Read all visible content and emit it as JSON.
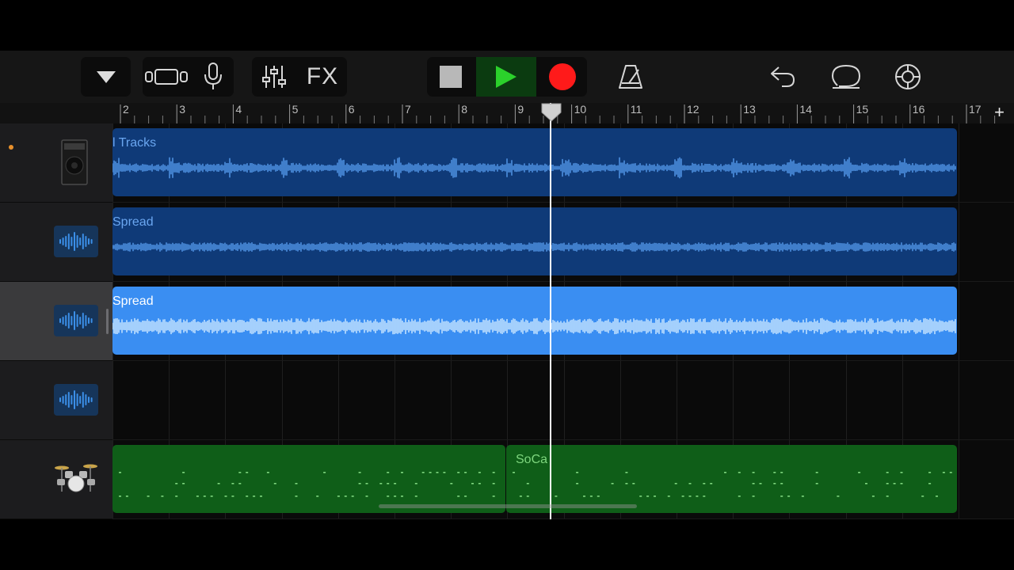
{
  "toolbar": {
    "buttons": [
      {
        "name": "browser",
        "icon": "triangle-down-icon"
      },
      {
        "name": "tracks-view",
        "icon": "tracks-view-icon"
      },
      {
        "name": "microphone",
        "icon": "microphone-icon"
      },
      {
        "name": "mixer",
        "icon": "mixer-sliders-icon"
      },
      {
        "name": "fx",
        "label": "FX"
      },
      {
        "name": "stop",
        "icon": "stop-icon"
      },
      {
        "name": "play",
        "icon": "play-icon"
      },
      {
        "name": "record",
        "icon": "record-icon"
      },
      {
        "name": "metronome",
        "icon": "metronome-icon"
      },
      {
        "name": "undo",
        "icon": "undo-icon"
      },
      {
        "name": "loop",
        "icon": "loop-icon"
      },
      {
        "name": "settings",
        "icon": "gear-icon"
      }
    ],
    "fx_label": "FX"
  },
  "ruler": {
    "bars": [
      "2",
      "3",
      "4",
      "5",
      "6",
      "7",
      "8",
      "9",
      "10",
      "11",
      "12",
      "13",
      "14",
      "15",
      "16",
      "17"
    ],
    "add_label": "+"
  },
  "tracks": [
    {
      "icon": "amp-icon",
      "selected": false,
      "region_label": "l Tracks",
      "type": "audio-dark",
      "recording_dot": true
    },
    {
      "icon": "waveform-icon",
      "selected": false,
      "region_label": "Spread",
      "type": "audio-dark"
    },
    {
      "icon": "waveform-icon",
      "selected": true,
      "region_label": "Spread",
      "type": "audio-light"
    },
    {
      "icon": "waveform-icon",
      "selected": false,
      "region_label": "",
      "type": "empty"
    },
    {
      "icon": "drum-kit-icon",
      "selected": false,
      "region_label": "SoCa",
      "type": "drummer"
    }
  ],
  "playhead_bar": 9.8,
  "colors": {
    "audio_dark_region": "#0f3a78",
    "audio_dark_wave": "#4d8fe0",
    "audio_light_region": "#3a8ef2",
    "audio_light_wave": "#bfe0ff",
    "drummer_region": "#0f5e18",
    "drummer_note": "#7ed67e",
    "play_accent": "#2bd12b",
    "record_accent": "#ff1a1a"
  }
}
